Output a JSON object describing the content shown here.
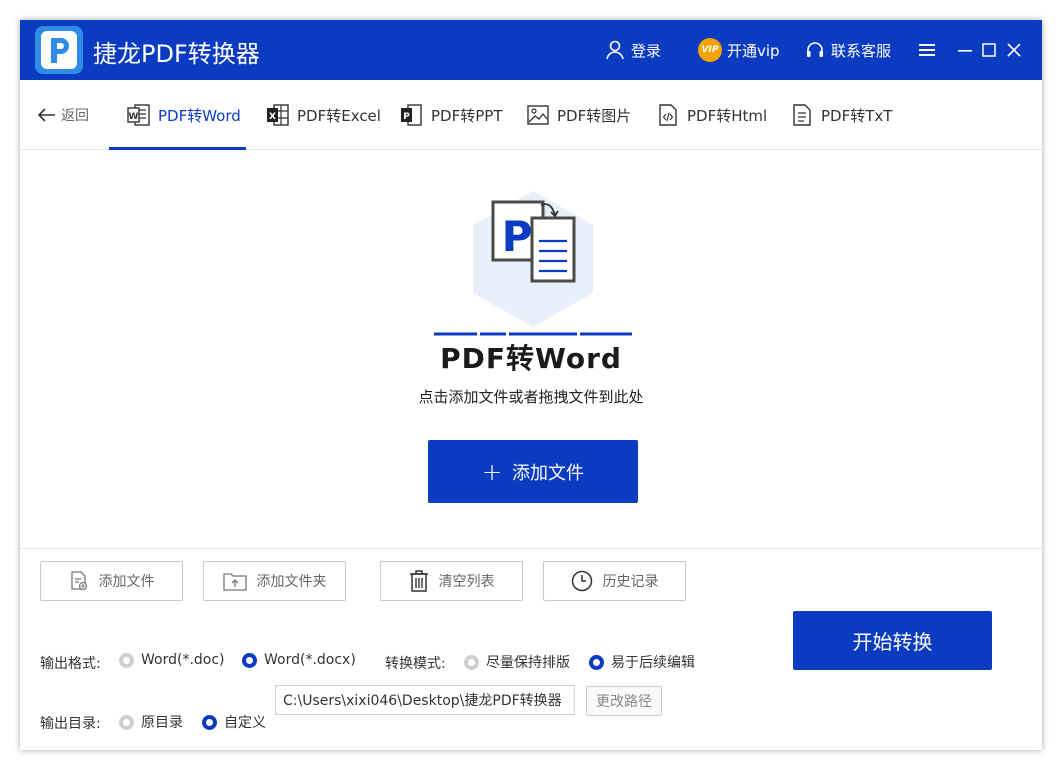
{
  "app": {
    "title": "捷龙PDF转换器",
    "login_label": "登录",
    "vip_badge": "VIP",
    "vip_label": "开通vip",
    "support_label": "联系客服",
    "accent_color": "#0a3bc0"
  },
  "nav": {
    "back_label": "返回",
    "tabs": [
      {
        "label": "PDF转Word",
        "icon": "word-icon",
        "active": true
      },
      {
        "label": "PDF转Excel",
        "icon": "excel-icon",
        "active": false
      },
      {
        "label": "PDF转PPT",
        "icon": "ppt-icon",
        "active": false
      },
      {
        "label": "PDF转图片",
        "icon": "image-icon",
        "active": false
      },
      {
        "label": "PDF转Html",
        "icon": "html-icon",
        "active": false
      },
      {
        "label": "PDF转TxT",
        "icon": "txt-icon",
        "active": false
      }
    ]
  },
  "dropzone": {
    "title": "PDF转Word",
    "subtitle": "点击添加文件或者拖拽文件到此处",
    "add_button_icon": "+",
    "add_button_label": "添加文件"
  },
  "toolbar": {
    "add_file": "添加文件",
    "add_folder": "添加文件夹",
    "clear_list": "清空列表",
    "history": "历史记录"
  },
  "options": {
    "format_label": "输出格式:",
    "format_options": [
      {
        "label": "Word(*.doc)",
        "checked": false
      },
      {
        "label": "Word(*.docx)",
        "checked": true
      }
    ],
    "mode_label": "转换模式:",
    "mode_options": [
      {
        "label": "尽量保持排版",
        "checked": false
      },
      {
        "label": "易于后续编辑",
        "checked": true
      }
    ],
    "dir_label": "输出目录:",
    "dir_options": [
      {
        "label": "原目录",
        "checked": false
      },
      {
        "label": "自定义",
        "checked": true
      }
    ],
    "path_value": "C:\\Users\\xixi046\\Desktop\\捷龙PDF转换器",
    "change_path_label": "更改路径",
    "start_label": "开始转换"
  }
}
